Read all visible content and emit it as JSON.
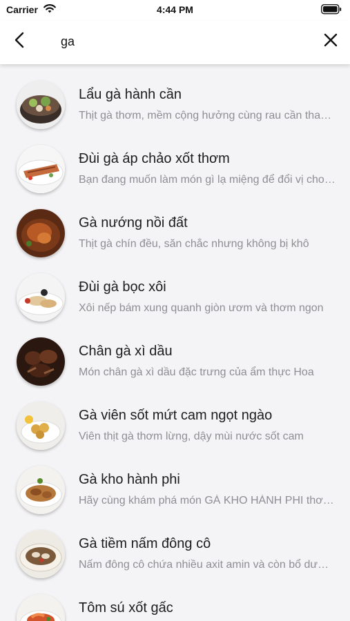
{
  "status_bar": {
    "carrier": "Carrier",
    "time": "4:44 PM"
  },
  "search": {
    "value": "ga",
    "placeholder": ""
  },
  "results": [
    {
      "title": "Lẩu gà hành cần",
      "description": "Thịt gà thơm, mềm cộng hưởng cùng rau cần thanh mát",
      "icon": "hotpot-dish-icon",
      "dish_color": "#5a4a3e"
    },
    {
      "title": "Đùi gà áp chảo xốt thơm",
      "description": "Bạn đang muốn làm món gì lạ miệng để đổi vị cho cả nhà",
      "icon": "pan-seared-chicken-dish-icon",
      "dish_color": "#c46a3c"
    },
    {
      "title": "Gà nướng nồi đất",
      "description": "Thịt gà chín đều, săn chắc nhưng không bị khô",
      "icon": "clay-pot-chicken-dish-icon",
      "dish_color": "#9a4a22"
    },
    {
      "title": "Đùi gà bọc xôi",
      "description": "Xôi nếp bám xung quanh giòn ươm và thơm ngon",
      "icon": "sticky-rice-chicken-dish-icon",
      "dish_color": "#e2c89a"
    },
    {
      "title": "Chân gà xì dầu",
      "description": "Món chân gà xì dầu đặc trưng của ẩm thực Hoa",
      "icon": "soy-chicken-feet-dish-icon",
      "dish_color": "#4a2a1a"
    },
    {
      "title": "Gà viên sốt mứt cam ngọt ngào",
      "description": "Viên thịt gà thơm lừng, dậy mùi nước sốt cam",
      "icon": "orange-chicken-balls-dish-icon",
      "dish_color": "#d9a441"
    },
    {
      "title": "Gà kho hành phi",
      "description": "Hãy cùng khám phá món GÀ KHO HÀNH PHI thơm ngon",
      "icon": "braised-chicken-dish-icon",
      "dish_color": "#b5773a"
    },
    {
      "title": "Gà tiềm nấm đông cô",
      "description": "Nấm đông cô chứa nhiều axit amin và còn bổ dưỡng",
      "icon": "mushroom-chicken-soup-dish-icon",
      "dish_color": "#7a5a3a"
    },
    {
      "title": "Tôm sú xốt gấc",
      "description": "",
      "icon": "shrimp-gac-sauce-dish-icon",
      "dish_color": "#d2542a"
    }
  ]
}
